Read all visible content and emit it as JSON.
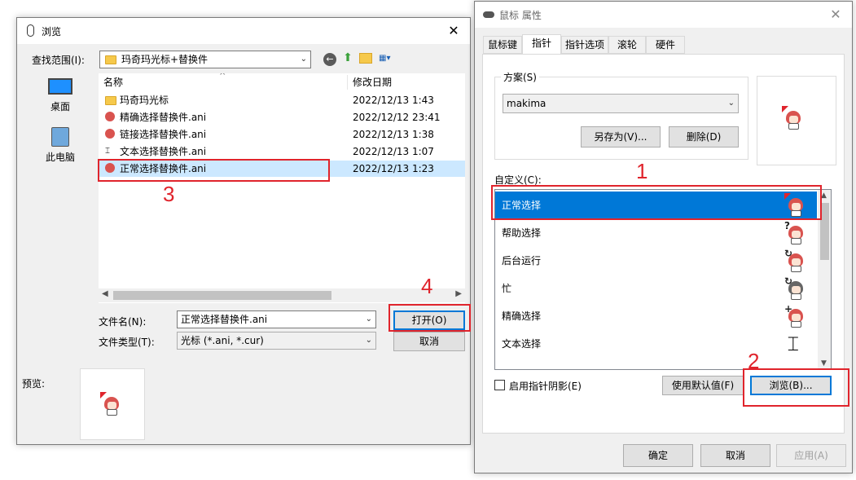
{
  "browse": {
    "title": "浏览",
    "close": "✕",
    "lookin_label": "查找范围(I):",
    "lookin_value": "玛奇玛光标+替换件",
    "places": [
      {
        "label": "桌面"
      },
      {
        "label": "此电脑"
      }
    ],
    "columns": {
      "name": "名称",
      "date": "修改日期"
    },
    "files": [
      {
        "name": "玛奇玛光标",
        "date": "2022/12/13 1:43",
        "icon": "folder-icon"
      },
      {
        "name": "精确选择替换件.ani",
        "date": "2022/12/12 23:41",
        "icon": "precision-cursor-icon"
      },
      {
        "name": "链接选择替换件.ani",
        "date": "2022/12/13 1:38",
        "icon": "link-cursor-icon"
      },
      {
        "name": "文本选择替换件.ani",
        "date": "2022/12/13 1:07",
        "icon": "text-cursor-icon"
      },
      {
        "name": "正常选择替换件.ani",
        "date": "2022/12/13 1:23",
        "icon": "normal-cursor-icon"
      }
    ],
    "filename_label": "文件名(N):",
    "filename_value": "正常选择替换件.ani",
    "filetype_label": "文件类型(T):",
    "filetype_value": "光标 (*.ani, *.cur)",
    "open_button": "打开(O)",
    "cancel_button": "取消",
    "preview_label": "预览:"
  },
  "props": {
    "title": "鼠标 属性",
    "close": "✕",
    "tabs": [
      "鼠标键",
      "指针",
      "指针选项",
      "滚轮",
      "硬件"
    ],
    "active_tab": "指针",
    "scheme_label": "方案(S)",
    "scheme_value": "makima",
    "save_as_button": "另存为(V)...",
    "delete_button": "删除(D)",
    "customize_label": "自定义(C):",
    "cursors": [
      {
        "name": "正常选择",
        "icon": "normal-select-cursor-icon"
      },
      {
        "name": "帮助选择",
        "icon": "help-select-cursor-icon"
      },
      {
        "name": "后台运行",
        "icon": "working-in-background-cursor-icon"
      },
      {
        "name": "忙",
        "icon": "busy-cursor-icon"
      },
      {
        "name": "精确选择",
        "icon": "precision-select-cursor-icon"
      },
      {
        "name": "文本选择",
        "icon": "text-select-cursor-icon"
      }
    ],
    "shadow_label": "启用指针阴影(E)",
    "default_button": "使用默认值(F)",
    "browse_button": "浏览(B)...",
    "ok_button": "确定",
    "cancel_button": "取消",
    "apply_button": "应用(A)"
  },
  "annotations": [
    "1",
    "2",
    "3",
    "4"
  ],
  "colors": {
    "accent": "#0078d7",
    "annotation": "#e0242c",
    "selection": "#cce8ff"
  }
}
